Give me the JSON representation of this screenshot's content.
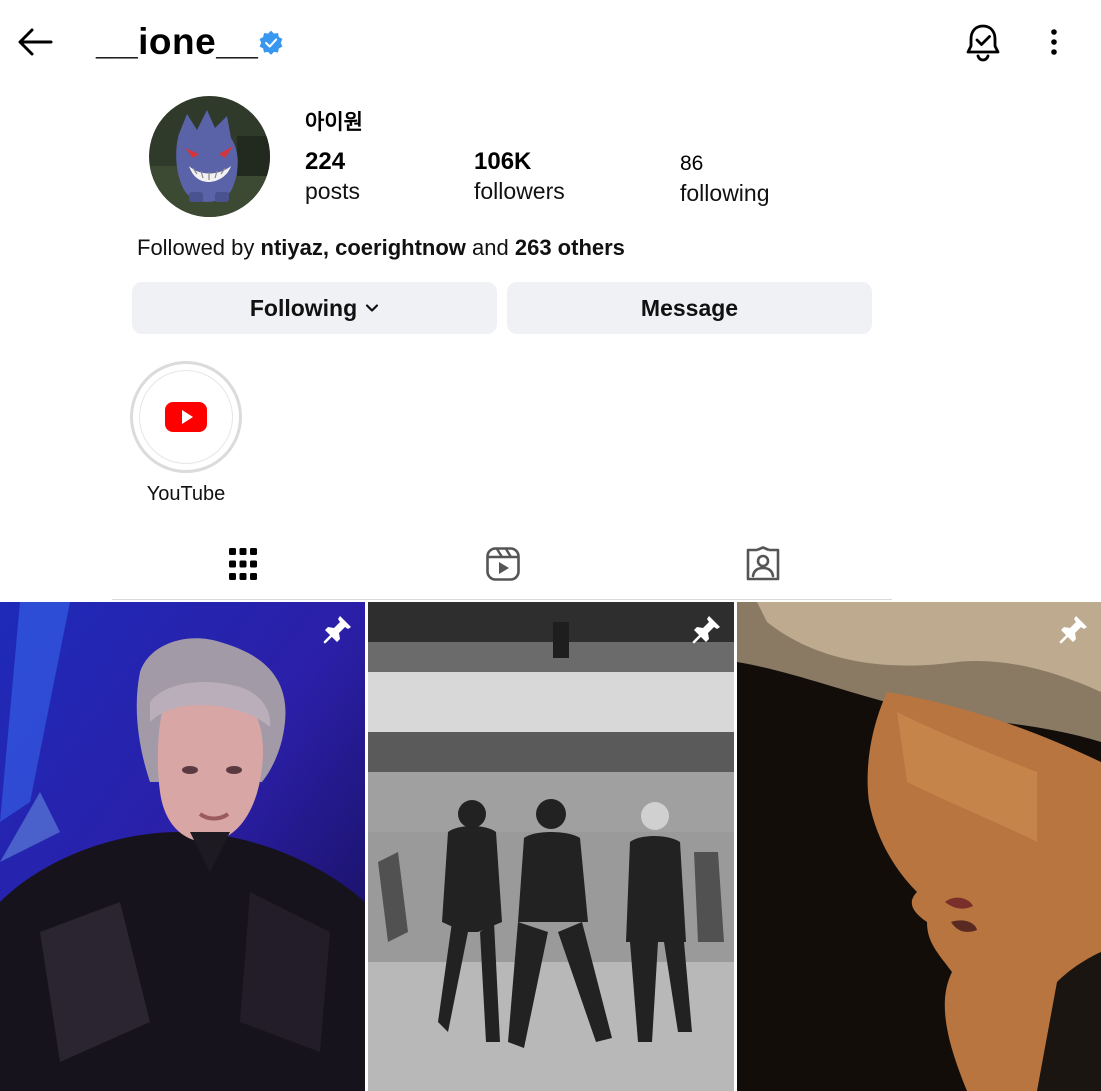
{
  "header": {
    "username": "__ione__",
    "icons": [
      "back-arrow-icon",
      "verified-badge-icon",
      "notification-bell-icon",
      "more-options-icon"
    ]
  },
  "profile": {
    "display_name": "아이원",
    "stats": {
      "posts": {
        "count": "224",
        "label": "posts"
      },
      "followers": {
        "count": "106K",
        "label": "followers"
      },
      "following": {
        "count": "86",
        "label": "following"
      }
    },
    "followed_by": {
      "prefix": "Followed by",
      "user1": "ntiyaz,",
      "user2": "coerightnow",
      "conj": "and",
      "others": "263 others"
    }
  },
  "buttons": {
    "following_label": "Following",
    "message_label": "Message"
  },
  "highlights": [
    {
      "label": "YouTube",
      "icon": "youtube-icon"
    }
  ],
  "tabs": [
    {
      "name": "posts-grid",
      "icon": "grid-icon",
      "active": true
    },
    {
      "name": "reels",
      "icon": "reels-icon",
      "active": false
    },
    {
      "name": "tagged",
      "icon": "tagged-person-icon",
      "active": false
    }
  ],
  "posts": [
    {
      "pinned": true,
      "icon": "pin-icon"
    },
    {
      "pinned": true,
      "icon": "pin-icon"
    },
    {
      "pinned": true,
      "icon": "pin-icon"
    }
  ],
  "colors": {
    "verified": "#3897f0",
    "button_bg": "#eff1f4",
    "youtube_red": "#ff0000"
  }
}
